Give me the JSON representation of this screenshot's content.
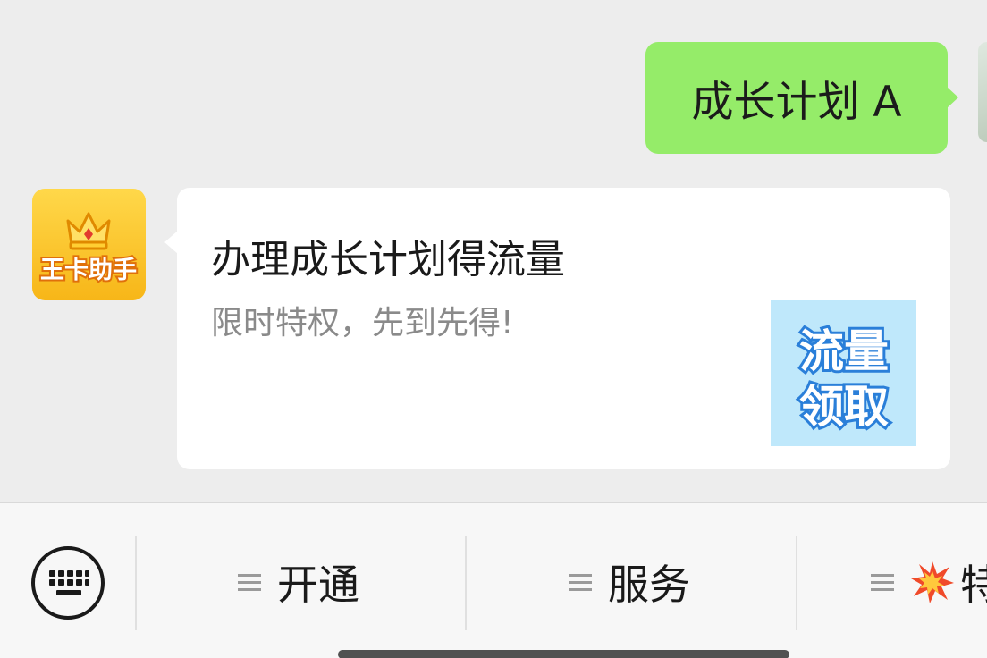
{
  "chat": {
    "outgoing_message": "成长计划 A",
    "bot_avatar_text": "王卡助手",
    "card": {
      "title": "办理成长计划得流量",
      "description": "限时特权，先到先得!",
      "thumbnail_line1": "流量",
      "thumbnail_line2": "领取"
    }
  },
  "menu": {
    "keyboard_icon": "keyboard-icon",
    "items": [
      {
        "label": "开通",
        "icon": "menu-lines-icon"
      },
      {
        "label": "服务",
        "icon": "menu-lines-icon"
      },
      {
        "label": "特",
        "icon": "menu-lines-icon",
        "emoji_icon": "collision-icon"
      }
    ]
  },
  "colors": {
    "background": "#ededed",
    "outgoing_bubble": "#95ec69",
    "card_background": "#ffffff",
    "thumbnail_background": "#bfe8fb",
    "avatar_yellow": "#f7b618"
  }
}
